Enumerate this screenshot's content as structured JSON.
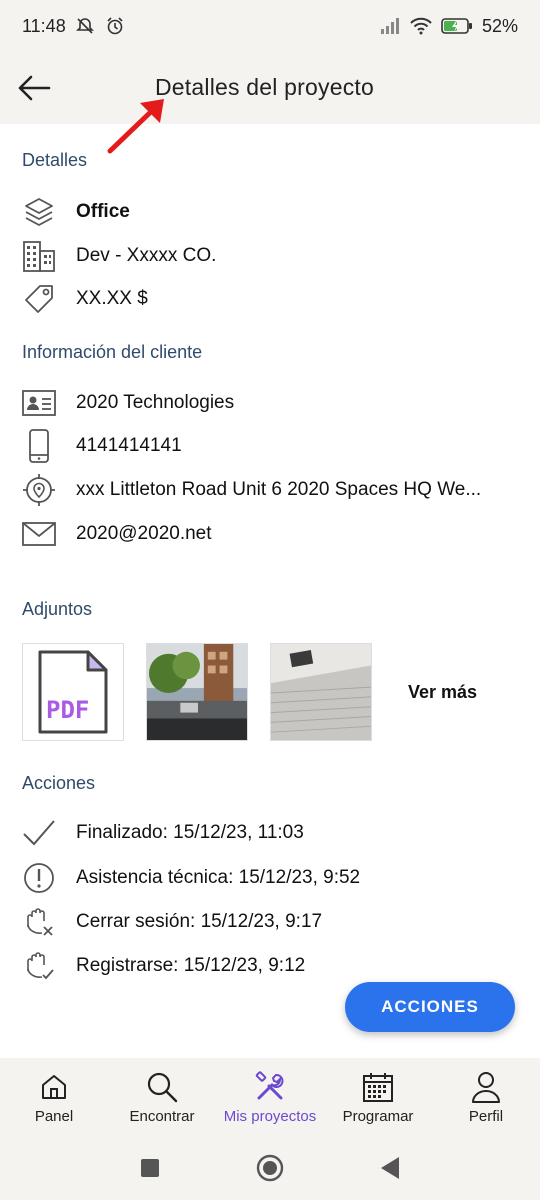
{
  "status_bar": {
    "time": "11:48",
    "battery": "52%"
  },
  "header": {
    "title": "Detalles del proyecto"
  },
  "details": {
    "section_title": "Detalles",
    "type": "Office",
    "company": "Dev - Xxxxx CO.",
    "price": "XX.XX  $"
  },
  "client": {
    "section_title": "Información del cliente",
    "name": "2020 Technologies",
    "phone": "4141414141",
    "address": "xxx Littleton Road Unit 6 2020 Spaces HQ We...",
    "email": "2020@2020.net"
  },
  "attachments": {
    "section_title": "Adjuntos",
    "pdf_label": "PDF",
    "see_more": "Ver más"
  },
  "actions": {
    "section_title": "Acciones",
    "items": [
      {
        "text": "Finalizado: 15/12/23, 11:03"
      },
      {
        "text": "Asistencia técnica: 15/12/23, 9:52"
      },
      {
        "text": "Cerrar sesión: 15/12/23, 9:17"
      },
      {
        "text": "Registrarse: 15/12/23, 9:12"
      }
    ],
    "fab_label": "ACCIONES"
  },
  "bottom_nav": {
    "items": [
      {
        "label": "Panel",
        "icon": "home-icon"
      },
      {
        "label": "Encontrar",
        "icon": "search-icon"
      },
      {
        "label": "Mis proyectos",
        "icon": "tools-icon"
      },
      {
        "label": "Programar",
        "icon": "calendar-icon"
      },
      {
        "label": "Perfil",
        "icon": "person-icon"
      }
    ]
  },
  "colors": {
    "accent": "#6b4ad0",
    "fab": "#2a73ec",
    "section": "#2f4a6b",
    "bar_bg": "#f5f3ef"
  }
}
